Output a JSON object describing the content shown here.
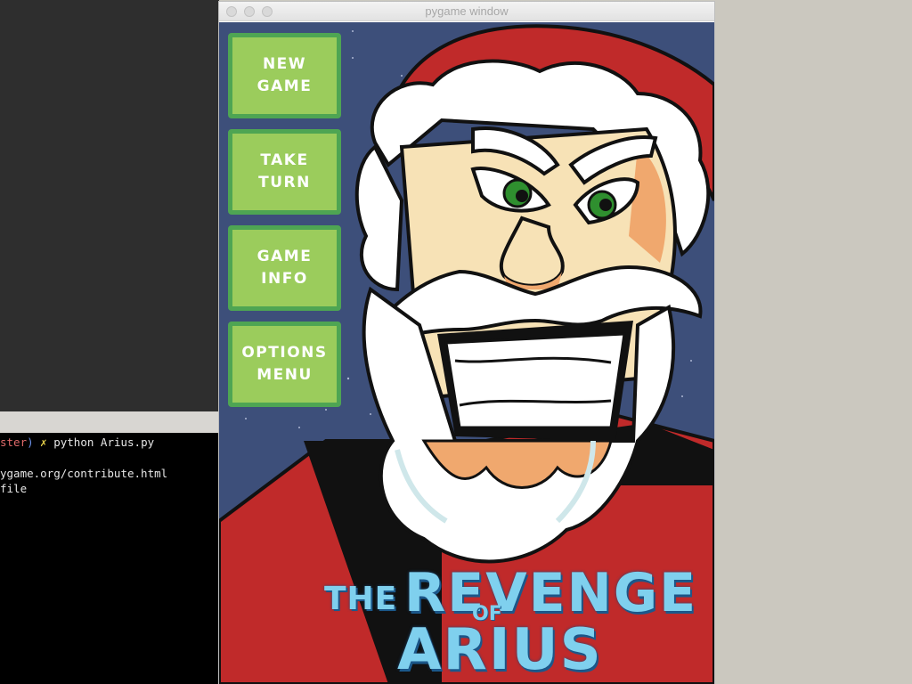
{
  "window": {
    "title": "pygame window"
  },
  "terminal": {
    "prompt_branch": "ster",
    "prompt_paren": ")",
    "prompt_mark": "✗",
    "command": "python Arius.py",
    "lines": [
      "ygame.org/contribute.html",
      "file"
    ]
  },
  "menu": {
    "new_game": "NEW\nGAME",
    "take_turn": "TAKE\nTURN",
    "game_info": "GAME\nINFO",
    "options_menu": "OPTIONS\nMENU"
  },
  "logo": {
    "the": "THE",
    "revenge": "REVENGE",
    "of": "OF",
    "arius": "ARIUS"
  },
  "colors": {
    "button_fill": "#9bcc5c",
    "button_border": "#4ea553",
    "logo_text": "#7fd0ee",
    "sky": "#3d4f7a",
    "santa_red": "#c02a2a"
  }
}
